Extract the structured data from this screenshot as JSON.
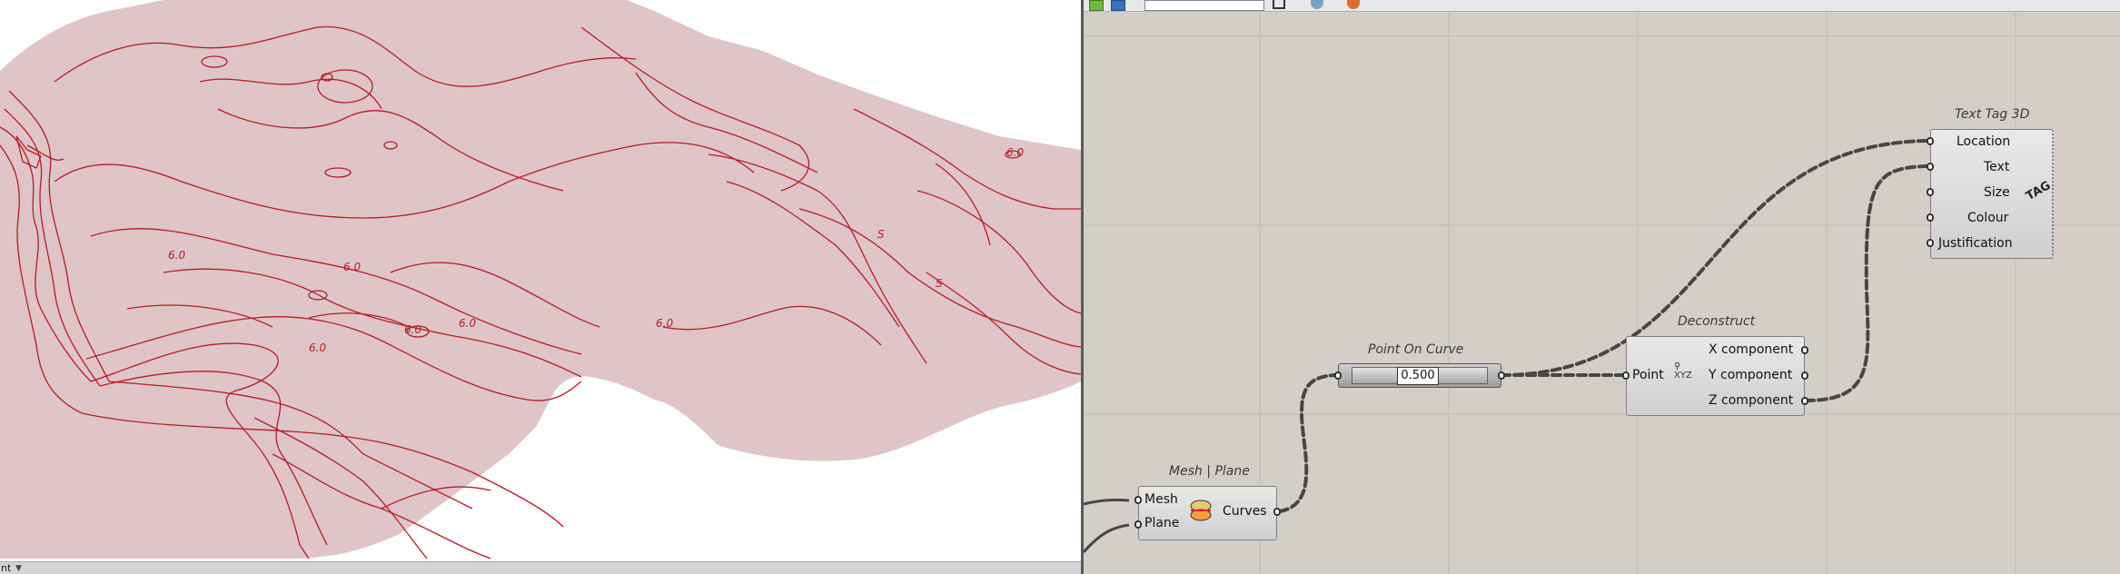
{
  "viewport": {
    "contour_labels": [
      "6.0",
      "6.0",
      "6.0",
      "6.0",
      "6.0",
      "6.0",
      "6.0",
      "S",
      "S"
    ],
    "statusbar_label": "nt"
  },
  "canvas": {
    "mesh_plane": {
      "title": "Mesh | Plane",
      "inputs": [
        "Mesh",
        "Plane"
      ],
      "output": "Curves"
    },
    "point_on_curve": {
      "title": "Point On Curve",
      "value": "0.500"
    },
    "deconstruct": {
      "title": "Deconstruct",
      "input": "Point",
      "icon_text": "XYZ",
      "outputs": [
        "X component",
        "Y component",
        "Z component"
      ]
    },
    "text_tag_3d": {
      "title": "Text Tag 3D",
      "inputs": [
        "Location",
        "Text",
        "Size",
        "Colour",
        "Justification"
      ],
      "icon_text": "TAG"
    }
  },
  "colors": {
    "terrain_fill": "#e0c5c8",
    "contour": "#b61c25",
    "canvas_bg": "#d3cfc8"
  }
}
